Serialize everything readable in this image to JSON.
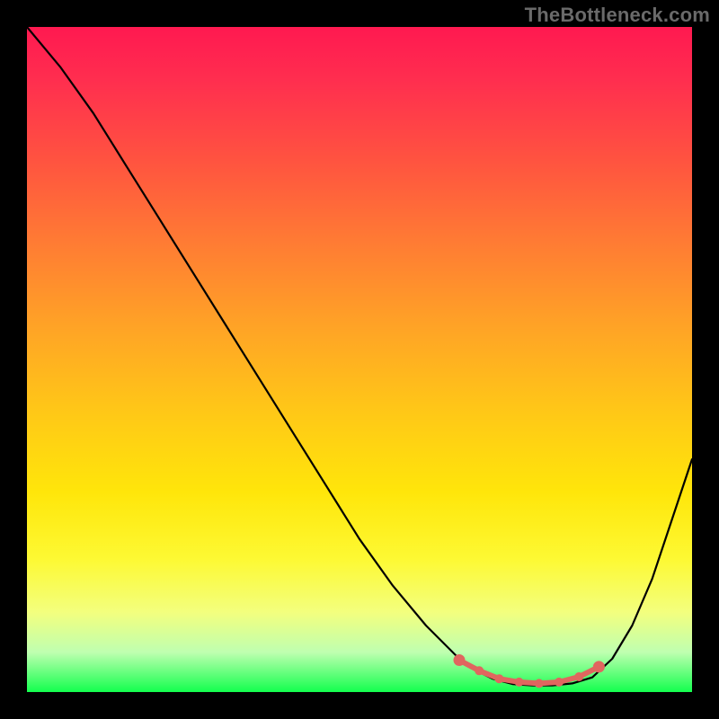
{
  "attribution": "TheBottleneck.com",
  "chart_data": {
    "type": "line",
    "title": "",
    "xlabel": "",
    "ylabel": "",
    "xlim": [
      0,
      100
    ],
    "ylim": [
      0,
      100
    ],
    "series": [
      {
        "name": "bottleneck-curve",
        "x": [
          0,
          5,
          10,
          15,
          20,
          25,
          30,
          35,
          40,
          45,
          50,
          55,
          60,
          65,
          67,
          70,
          73,
          76,
          79,
          82,
          85,
          88,
          91,
          94,
          97,
          100
        ],
        "y": [
          100,
          94,
          87,
          79,
          71,
          63,
          55,
          47,
          39,
          31,
          23,
          16,
          10,
          5,
          3.5,
          2,
          1.2,
          1,
          1,
          1.3,
          2.2,
          5,
          10,
          17,
          26,
          35
        ]
      }
    ],
    "highlight": {
      "name": "optimal-range",
      "x": [
        65,
        68,
        71,
        74,
        77,
        80,
        83,
        86
      ],
      "y": [
        4.8,
        3.2,
        2.0,
        1.5,
        1.3,
        1.5,
        2.3,
        3.8
      ]
    },
    "gradient_stops": [
      {
        "pos": 0.0,
        "color": "#ff1950"
      },
      {
        "pos": 0.2,
        "color": "#ff5340"
      },
      {
        "pos": 0.45,
        "color": "#ffa326"
      },
      {
        "pos": 0.7,
        "color": "#ffe60a"
      },
      {
        "pos": 0.88,
        "color": "#f3ff7e"
      },
      {
        "pos": 1.0,
        "color": "#13ff4e"
      }
    ]
  }
}
